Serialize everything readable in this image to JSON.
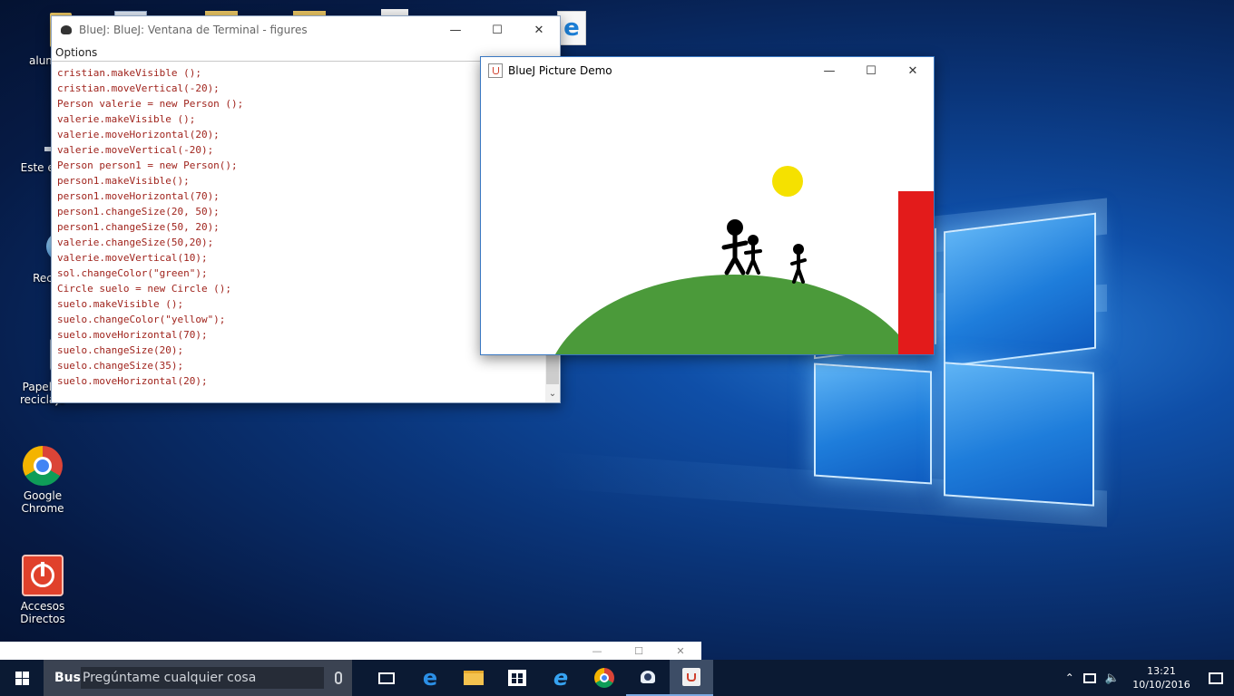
{
  "desktop": {
    "icons": [
      {
        "label": "alum"
      },
      {
        "label": "Este eq"
      },
      {
        "label": "Rec"
      },
      {
        "label": "Papeler\nreciclaje"
      },
      {
        "label": "Google Chrome"
      },
      {
        "label": "Accesos Directos"
      }
    ]
  },
  "terminal": {
    "title": "BlueJ: BlueJ:  Ventana de Terminal - figures",
    "menu": "Options",
    "lines": [
      "cristian.makeVisible ();",
      "cristian.moveVertical(-20);",
      "Person valerie = new Person ();",
      "valerie.makeVisible ();",
      "valerie.moveHorizontal(20);",
      "valerie.moveVertical(-20);",
      "Person person1 = new Person();",
      "person1.makeVisible();",
      "person1.moveHorizontal(70);",
      "person1.changeSize(20, 50);",
      "person1.changeSize(50, 20);",
      "valerie.changeSize(50,20);",
      "valerie.moveVertical(10);",
      "sol.changeColor(\"green\");",
      "Circle suelo = new Circle ();",
      "suelo.makeVisible ();",
      "suelo.changeColor(\"yellow\");",
      "suelo.moveHorizontal(70);",
      "suelo.changeSize(20);",
      "suelo.changeSize(35);",
      "suelo.moveHorizontal(20);"
    ]
  },
  "picture": {
    "title": "BlueJ Picture Demo",
    "colors": {
      "sun": "#f5e100",
      "hill": "#4b9a3a",
      "wall": "#e31b1b",
      "person": "#000000"
    }
  },
  "taskbar": {
    "search_prefix": "Bus",
    "search_placeholder": "Pregúntame cualquier cosa",
    "time": "13:21",
    "date": "10/10/2016"
  }
}
